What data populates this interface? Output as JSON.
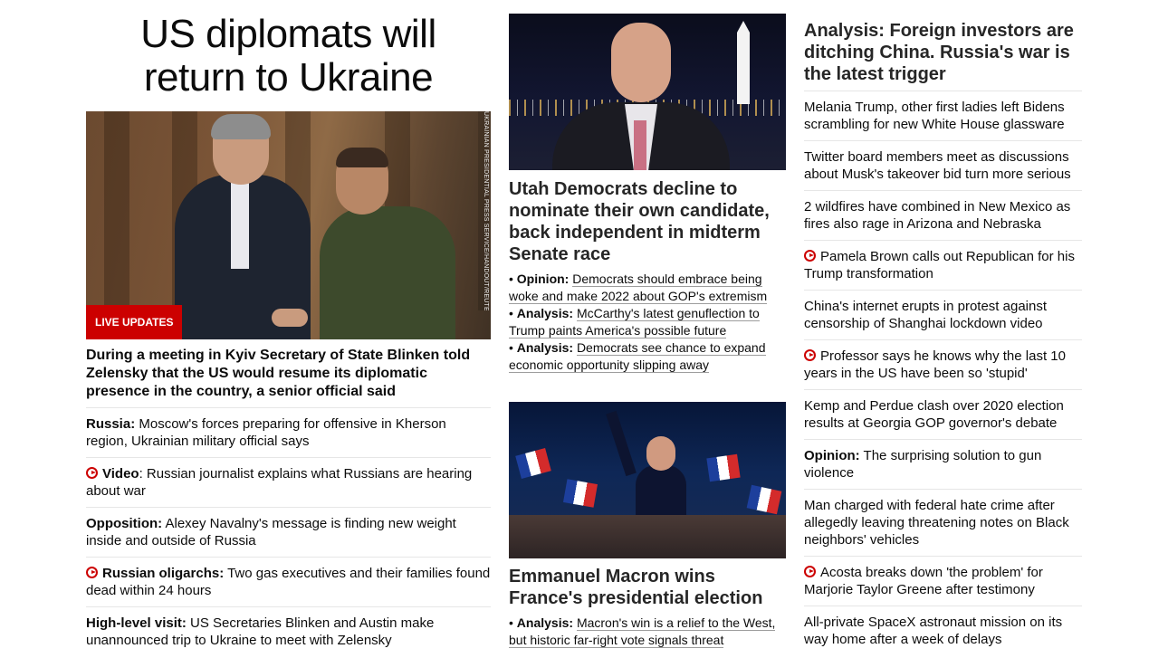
{
  "lead": {
    "headline": "US diplomats will return to Ukraine",
    "photo_credit": "UKRAINIAN PRESIDENTIAL PRESS SERVICE/HANDOUT/REUTERS",
    "badge": "LIVE UPDATES",
    "description": "During a meeting in Kyiv Secretary of State Blinken told Zelensky that the US would resume its diplomatic presence in the country, a senior official said",
    "items": [
      {
        "label": "Russia:",
        "text": " Moscow's forces preparing for offensive in Kherson region, Ukrainian military official says",
        "video": false
      },
      {
        "label": "Video",
        "text": ": Russian journalist explains what Russians are hearing about war",
        "video": true
      },
      {
        "label": "Opposition:",
        "text": " Alexey Navalny's message is finding new weight inside and outside of Russia",
        "video": false
      },
      {
        "label": "Russian oligarchs:",
        "text": " Two gas executives and their families found dead within 24 hours",
        "video": true
      },
      {
        "label": "High-level visit:",
        "text": " US Secretaries Blinken and Austin make unannounced trip to Ukraine to meet with Zelensky",
        "video": false
      }
    ]
  },
  "middle": {
    "story1": {
      "title": "Utah Democrats decline to nominate their own candidate, back independent in midterm Senate race",
      "links": [
        {
          "label": "Opinion:",
          "text": "Democrats should embrace being woke and make 2022 about GOP's extremism"
        },
        {
          "label": "Analysis:",
          "text": "McCarthy's latest genuflection to Trump paints America's possible future"
        },
        {
          "label": "Analysis:",
          "text": "Democrats see chance to expand economic opportunity slipping away"
        }
      ]
    },
    "story2": {
      "title": "Emmanuel Macron wins France's presidential election",
      "links": [
        {
          "label": "Analysis:",
          "text": "Macron's win is a relief to the West, but historic far-right vote signals threat"
        }
      ]
    }
  },
  "side": {
    "title": "Analysis: Foreign investors are ditching China. Russia's war is the latest trigger",
    "items": [
      {
        "label": "",
        "text": "Melania Trump, other first ladies left Bidens scrambling for new White House glassware",
        "video": false
      },
      {
        "label": "",
        "text": "Twitter board members meet as discussions about Musk's takeover bid turn more serious",
        "video": false
      },
      {
        "label": "",
        "text": "2 wildfires have combined in New Mexico as fires also rage in Arizona and Nebraska",
        "video": false
      },
      {
        "label": "",
        "text": "Pamela Brown calls out Republican for his Trump transformation",
        "video": true
      },
      {
        "label": "",
        "text": "China's internet erupts in protest against censorship of Shanghai lockdown video",
        "video": false
      },
      {
        "label": "",
        "text": "Professor says he knows why the last 10 years in the US have been so 'stupid'",
        "video": true
      },
      {
        "label": "",
        "text": "Kemp and Perdue clash over 2020 election results at Georgia GOP governor's debate",
        "video": false
      },
      {
        "label": "Opinion:",
        "text": " The surprising solution to gun violence",
        "video": false
      },
      {
        "label": "",
        "text": "Man charged with federal hate crime after allegedly leaving threatening notes on Black neighbors' vehicles",
        "video": false
      },
      {
        "label": "",
        "text": "Acosta breaks down 'the problem' for Marjorie Taylor Greene after testimony",
        "video": true
      },
      {
        "label": "",
        "text": "All-private SpaceX astronaut mission on its way home after a week of delays",
        "video": false
      }
    ]
  },
  "colors": {
    "accent": "#cc0000",
    "divider": "#e6e6e6",
    "text": "#0c0c0c"
  }
}
